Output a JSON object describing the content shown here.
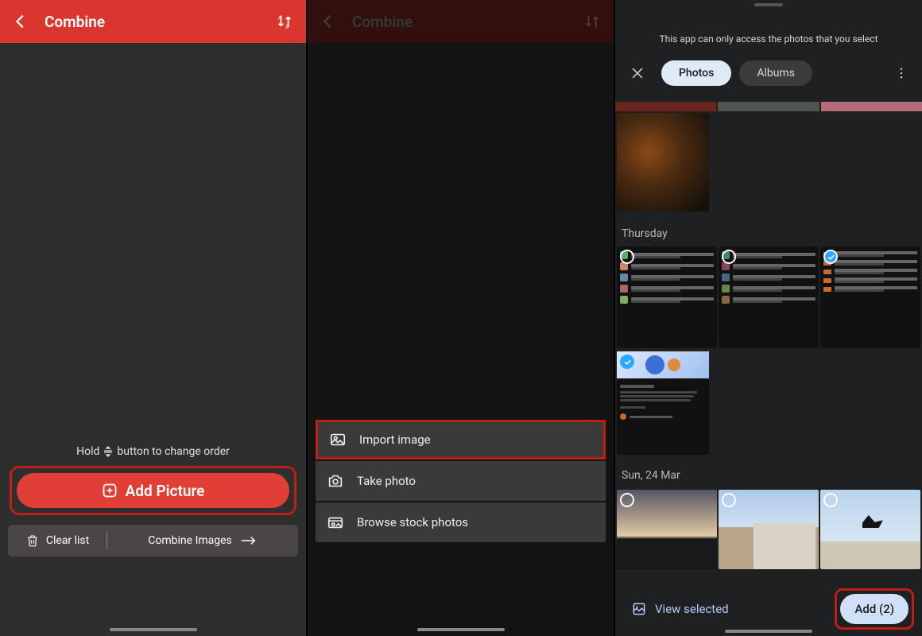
{
  "panel1": {
    "title": "Combine",
    "hint_before": "Hold",
    "hint_after": "button to change order",
    "add_picture": "Add Picture",
    "clear_list": "Clear list",
    "combine_images": "Combine Images"
  },
  "panel2": {
    "title": "Combine",
    "options": {
      "import": "Import image",
      "take": "Take photo",
      "stock": "Browse stock photos"
    }
  },
  "panel3": {
    "notice": "This app can only access the photos that you select",
    "tab_photos": "Photos",
    "tab_albums": "Albums",
    "day1": "Thursday",
    "day2": "Sun, 24 Mar",
    "view_selected": "View selected",
    "add_btn": "Add (2)"
  }
}
